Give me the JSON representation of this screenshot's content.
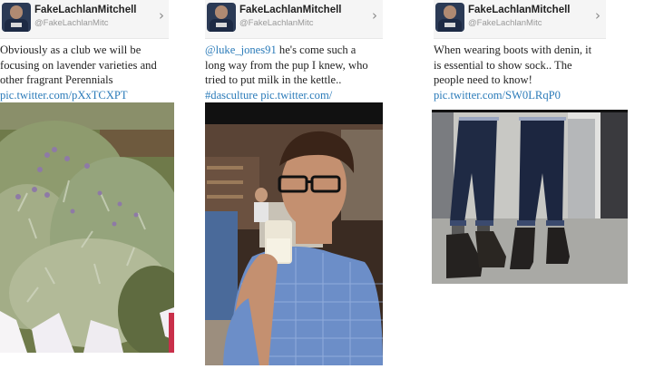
{
  "tweets": [
    {
      "display_name": "FakeLachlanMitchell",
      "handle": "@FakeLachlanMitc",
      "line1": "Obviously as a club we will be",
      "line2": "focusing on lavender varieties and",
      "line3": "other fragrant Perennials",
      "link": "pic.twitter.com/pXxTCXPT"
    },
    {
      "display_name": "FakeLachlanMitchell",
      "handle": "@FakeLachlanMitc",
      "mention": "@luke_jones91",
      "line1_rest": " he's come such a",
      "line2": "long way from the pup I knew, who",
      "line3": "tried to put milk in the kettle..",
      "hashtag": "#dasculture",
      "link": "pic.twitter.com/"
    },
    {
      "display_name": "FakeLachlanMitchell",
      "handle": "@FakeLachlanMitc",
      "line1": "When wearing boots with denin, it",
      "line2": "is essential to show sock.. The",
      "line3": "people need to know!",
      "link": "pic.twitter.com/SW0LRqP0"
    }
  ],
  "icons": {
    "chevron": "›",
    "avatar": "avatar-icon",
    "photo_1": "lavender-plants-photo",
    "photo_2": "man-drinking-milk-photo",
    "photo_3": "jeans-and-boots-photo"
  },
  "colors": {
    "link": "#2b7bb9",
    "header_bg": "#f5f5f5",
    "text": "#222222",
    "handle": "#999999"
  }
}
